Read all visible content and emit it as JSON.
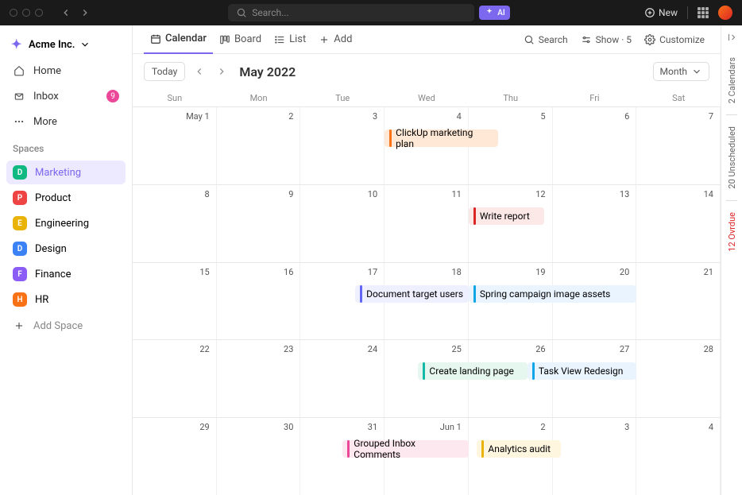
{
  "titlebar": {
    "search_placeholder": "Search...",
    "ai_label": "AI",
    "new_label": "New"
  },
  "sidebar": {
    "workspace_name": "Acme Inc.",
    "nav": {
      "home": "Home",
      "inbox": "Inbox",
      "inbox_badge": "9",
      "more": "More"
    },
    "spaces_header": "Spaces",
    "spaces": [
      {
        "letter": "D",
        "label": "Marketing",
        "color": "#10b981",
        "active": true
      },
      {
        "letter": "P",
        "label": "Product",
        "color": "#ef4444"
      },
      {
        "letter": "E",
        "label": "Engineering",
        "color": "#eab308"
      },
      {
        "letter": "D",
        "label": "Design",
        "color": "#3b82f6"
      },
      {
        "letter": "F",
        "label": "Finance",
        "color": "#8b5cf6"
      },
      {
        "letter": "H",
        "label": "HR",
        "color": "#f97316"
      }
    ],
    "add_space_label": "Add Space"
  },
  "view_tabs": {
    "calendar": "Calendar",
    "board": "Board",
    "list": "List",
    "add": "Add",
    "search": "Search",
    "show": "Show · 5",
    "customize": "Customize"
  },
  "calendar": {
    "today_label": "Today",
    "title": "May 2022",
    "period": "Month",
    "day_headers": [
      "Sun",
      "Mon",
      "Tue",
      "Wed",
      "Thu",
      "Fri",
      "Sat"
    ],
    "weeks": [
      [
        "May 1",
        "2",
        "3",
        "4",
        "5",
        "6",
        "7"
      ],
      [
        "8",
        "9",
        "10",
        "11",
        "12",
        "13",
        "14"
      ],
      [
        "15",
        "16",
        "17",
        "18",
        "19",
        "20",
        "21"
      ],
      [
        "22",
        "23",
        "24",
        "25",
        "26",
        "27",
        "28"
      ],
      [
        "29",
        "30",
        "31",
        "Jun 1",
        "2",
        "3",
        "4"
      ]
    ],
    "events": [
      {
        "row": 0,
        "start": 3,
        "span": 1.35,
        "title": "ClickUp marketing plan",
        "bg": "#ffe9d6",
        "bar": "#f97316"
      },
      {
        "row": 1,
        "start": 4,
        "span": 0.9,
        "title": "Write report",
        "bg": "#fde8e8",
        "bar": "#dc2626"
      },
      {
        "row": 2,
        "start": 2.65,
        "span": 1.35,
        "title": "Document target users",
        "bg": "#eef0ff",
        "bar": "#6366f1"
      },
      {
        "row": 2,
        "start": 4,
        "span": 2,
        "title": "Spring campaign image assets",
        "bg": "#eaf4ff",
        "bar": "#0ea5e9"
      },
      {
        "row": 3,
        "start": 3.4,
        "span": 1.3,
        "title": "Create landing page",
        "bg": "#e6f7f0",
        "bar": "#14b8a6"
      },
      {
        "row": 3,
        "start": 4.7,
        "span": 1.3,
        "title": "Task View Redesign",
        "bg": "#eaf4ff",
        "bar": "#0ea5e9"
      },
      {
        "row": 4,
        "start": 2.5,
        "span": 1.5,
        "title": "Grouped Inbox Comments",
        "bg": "#fde8ef",
        "bar": "#ec4899"
      },
      {
        "row": 4,
        "start": 4.1,
        "span": 1,
        "title": "Analytics audit",
        "bg": "#fff6e0",
        "bar": "#eab308"
      }
    ]
  },
  "rail": {
    "calendars": "2 Calendars",
    "unscheduled": "20 Unscheduled",
    "overdue": "12 Ovrdue"
  }
}
